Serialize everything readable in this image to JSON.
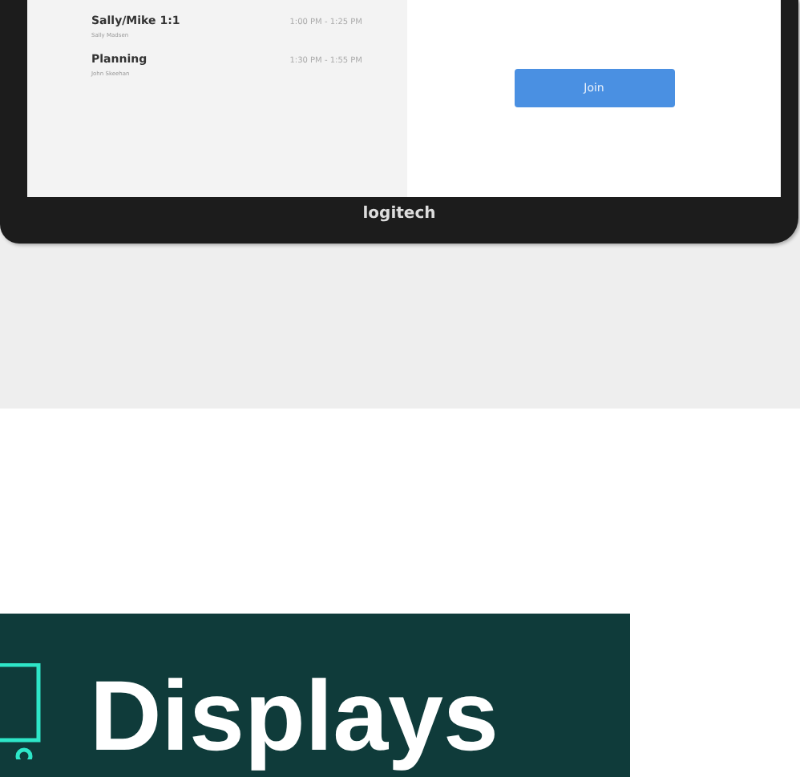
{
  "device_screen": {
    "meetings": [
      {
        "title": "Sally/Mike 1:1",
        "organizer": "Sally Madsen",
        "time": "1:00 PM - 1:25 PM"
      },
      {
        "title": "Planning",
        "organizer": "John Skeehan",
        "time": "1:30 PM - 1:55 PM"
      }
    ],
    "join_button": "Join"
  },
  "device_brand": "logitech",
  "banner": {
    "title": "Displays"
  }
}
